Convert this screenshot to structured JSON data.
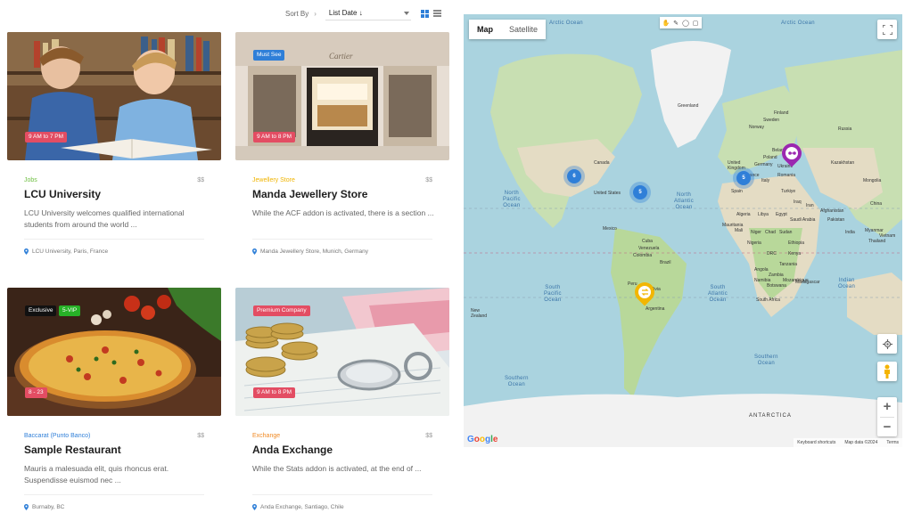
{
  "toolbar": {
    "sort_label": "Sort By",
    "sort_value": "List Date ↓",
    "grid_view_icon": "grid-icon",
    "list_view_icon": "list-icon"
  },
  "listings": [
    {
      "hours": "9 AM to 7 PM",
      "badges": [],
      "category": "Jobs",
      "category_color": "#6fbf43",
      "price": "$$",
      "title": "LCU University",
      "description": "LCU University welcomes qualified international students from around the world ...",
      "location": "LCU University, Paris, France"
    },
    {
      "hours": "9 AM to 8 PM",
      "badges": [
        {
          "text": "Must See",
          "color": "#2f7fd8"
        }
      ],
      "category": "Jewellery Store",
      "category_color": "#f0b400",
      "price": "$$",
      "title": "Manda Jewellery Store",
      "description": "While the ACF addon is activated, there is a section ...",
      "location": "Manda Jewellery Store, Munich, Germany"
    },
    {
      "hours": "8 - 23",
      "badges": [
        {
          "text": "Exclusive",
          "color": "#111111"
        },
        {
          "text": "5-VIP",
          "color": "#27b227"
        }
      ],
      "category": "Baccarat (Punto Banco)",
      "category_color": "#2f7fd8",
      "price": "$$",
      "title": "Sample Restaurant",
      "description": "Mauris a malesuada elit, quis rhoncus erat. Suspendisse euismod nec ...",
      "location": "Burnaby, BC"
    },
    {
      "hours": "9 AM to 8 PM",
      "badges": [
        {
          "text": "Premium Company",
          "color": "#e34d63"
        }
      ],
      "category": "Exchange",
      "category_color": "#f08a24",
      "price": "$$",
      "title": "Anda Exchange",
      "description": "While the Stats addon is activated, at the end of ...",
      "location": "Anda Exchange, Santiago, Chile"
    }
  ],
  "map": {
    "type_map": "Map",
    "type_satellite": "Satellite",
    "oceans": {
      "arctic_left": "Arctic Ocean",
      "arctic_right": "Arctic Ocean",
      "north_pacific": "North\nPacific\nOcean",
      "north_atlantic": "North\nAtlantic\nOcean",
      "south_pacific": "South\nPacific\nOcean",
      "south_atlantic": "South\nAtlantic\nOcean",
      "indian": "Indian\nOcean",
      "southern_left": "Southern\nOcean",
      "southern_right": "Southern\nOcean"
    },
    "labels": {
      "greenland": "Greenland",
      "united_states": "United States",
      "canada": "Canada",
      "brazil": "Brazil",
      "argentina": "Argentina",
      "new_zealand": "New\nZealand",
      "antarctica": "ANTARCTICA",
      "russia": "Russia",
      "china": "China",
      "kazakhstan": "Kazakhstan",
      "india": "India",
      "algeria": "Algeria",
      "libya": "Libya",
      "egypt": "Egypt",
      "niger": "Niger",
      "chad": "Chad",
      "sudan": "Sudan",
      "nigeria": "Nigeria",
      "ethiopia": "Ethiopia",
      "drc": "DRC",
      "tanzania": "Tanzania",
      "angola": "Angola",
      "namibia": "Namibia",
      "south_africa": "South Africa",
      "madagascar": "Madagascar",
      "mongolia": "Mongolia",
      "iran": "Iran",
      "iraq": "Iraq",
      "saudi_arabia": "Saudi Arabia",
      "turkey": "Turkiye",
      "ukraine": "Ukraine",
      "spain": "Spain",
      "united_kingdom": "United\nKingdom",
      "norway": "Norway",
      "sweden": "Sweden",
      "finland": "Finland",
      "mexico": "Mexico",
      "venezuela": "Venezuela",
      "colombia": "Colombia",
      "peru": "Peru",
      "bolivia": "Bolivia",
      "botswana": "Botswana",
      "mali": "Mali",
      "mauritania": "Mauritania",
      "cuba": "Cuba",
      "pakistan": "Pakistan",
      "afghanistan": "Afghanistan",
      "kenya": "Kenya",
      "mozambique": "Mozambique",
      "zambia": "Zambia",
      "vietnam": "Vietnam",
      "thailand": "Thailand",
      "myanmar": "Myanmar",
      "poland": "Poland",
      "germany": "Germany",
      "france": "France",
      "italy": "Italy",
      "romania": "Romania",
      "belarus": "Belarus"
    },
    "clusters": [
      {
        "count": "6"
      },
      {
        "count": "5"
      },
      {
        "count": "5"
      }
    ],
    "markers": [
      {
        "icon": "glasses-icon",
        "color": "#9b27b0"
      },
      {
        "icon": "exchange-icon",
        "color": "#f2b600"
      }
    ],
    "google": "Google",
    "attribution": {
      "shortcuts": "Keyboard shortcuts",
      "data": "Map data ©2024",
      "terms": "Terms"
    }
  }
}
